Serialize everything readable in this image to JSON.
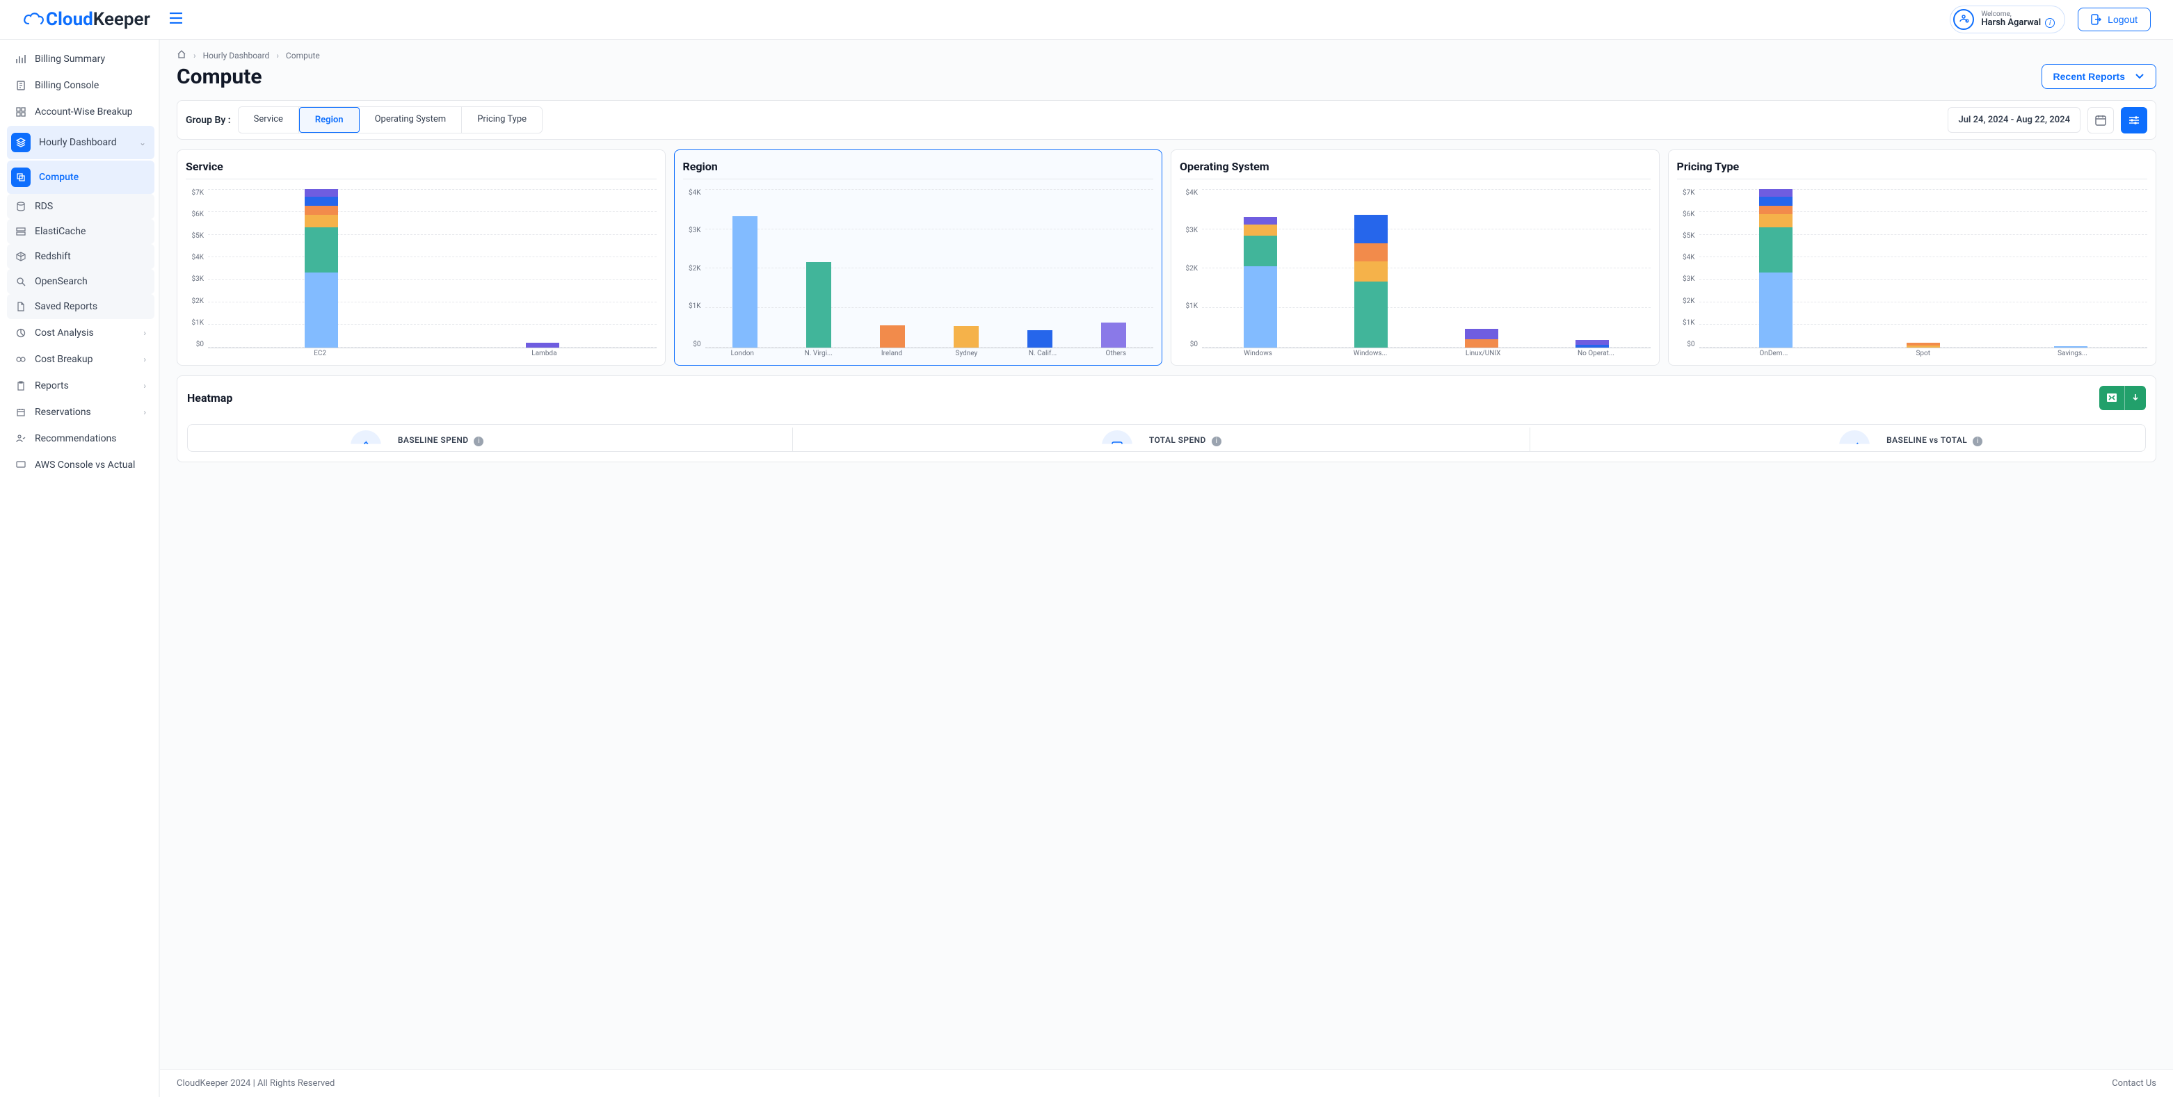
{
  "header": {
    "logo_part1": "Cloud",
    "logo_part2": "Keeper",
    "welcome_label": "Welcome,",
    "user_name": "Harsh Agarwal",
    "logout_label": "Logout"
  },
  "sidebar": {
    "items": {
      "billing_summary": "Billing Summary",
      "billing_console": "Billing Console",
      "account_wise": "Account-Wise Breakup",
      "hourly_dashboard": "Hourly Dashboard",
      "compute": "Compute",
      "rds": "RDS",
      "elasticache": "ElastiCache",
      "redshift": "Redshift",
      "opensearch": "OpenSearch",
      "saved_reports": "Saved Reports",
      "cost_analysis": "Cost Analysis",
      "cost_breakup": "Cost Breakup",
      "reports": "Reports",
      "reservations": "Reservations",
      "recommendations": "Recommendations",
      "aws_console_vs_actual": "AWS Console vs Actual"
    }
  },
  "breadcrumb": {
    "level1": "Hourly Dashboard",
    "level2": "Compute"
  },
  "page": {
    "title": "Compute",
    "recent_reports_label": "Recent Reports",
    "group_by_label": "Group By :",
    "group_by_options": {
      "service": "Service",
      "region": "Region",
      "os": "Operating System",
      "pricing": "Pricing Type"
    },
    "date_range": "Jul 24, 2024 - Aug 22, 2024"
  },
  "heatmap": {
    "title": "Heatmap",
    "baseline_spend_label": "BASELINE SPEND",
    "total_spend_label": "TOTAL SPEND",
    "baseline_vs_total_label": "BASELINE vs TOTAL"
  },
  "footer": {
    "copyright": "CloudKeeper 2024 | All Rights Reserved",
    "contact": "Contact Us"
  },
  "chart_data": [
    {
      "type": "bar",
      "title": "Service",
      "categories": [
        "EC2",
        "Lambda"
      ],
      "ylim": [
        0,
        7000
      ],
      "yticks": [
        "$7K",
        "$6K",
        "$5K",
        "$4K",
        "$3K",
        "$2K",
        "$1K",
        "$0"
      ],
      "series": [
        {
          "name": "sky",
          "color": "#82bbff",
          "values": [
            3000,
            0
          ]
        },
        {
          "name": "teal",
          "color": "#41b59a",
          "values": [
            1800,
            0
          ]
        },
        {
          "name": "amber",
          "color": "#f5b24a",
          "values": [
            500,
            0
          ]
        },
        {
          "name": "orange",
          "color": "#f28b4b",
          "values": [
            350,
            0
          ]
        },
        {
          "name": "blue",
          "color": "#2666eb",
          "values": [
            380,
            0
          ]
        },
        {
          "name": "violet",
          "color": "#6f5de0",
          "values": [
            300,
            180
          ]
        }
      ]
    },
    {
      "type": "bar",
      "title": "Region",
      "categories": [
        "London",
        "N. Virgi...",
        "Ireland",
        "Sydney",
        "N. Calif...",
        "Others"
      ],
      "ylim": [
        0,
        4000
      ],
      "yticks": [
        "$4K",
        "$3K",
        "$2K",
        "$1K",
        "$0"
      ],
      "series": [
        {
          "name": "value",
          "colors": [
            "#82bbff",
            "#41b59a",
            "#f28b4b",
            "#f5b24a",
            "#2666eb",
            "#8a79e8"
          ],
          "values": [
            3000,
            1950,
            510,
            490,
            400,
            570
          ]
        }
      ]
    },
    {
      "type": "bar",
      "title": "Operating System",
      "categories": [
        "Windows",
        "Windows...",
        "Linux/UNIX",
        "No Operat..."
      ],
      "ylim": [
        0,
        4000
      ],
      "yticks": [
        "$4K",
        "$3K",
        "$2K",
        "$1K",
        "$0"
      ],
      "series": [
        {
          "name": "sky",
          "color": "#82bbff",
          "values": [
            1850,
            0,
            0,
            0
          ]
        },
        {
          "name": "teal",
          "color": "#41b59a",
          "values": [
            700,
            1500,
            0,
            0
          ]
        },
        {
          "name": "amber",
          "color": "#f5b24a",
          "values": [
            250,
            460,
            0,
            0
          ]
        },
        {
          "name": "orange",
          "color": "#f28b4b",
          "values": [
            0,
            420,
            190,
            0
          ]
        },
        {
          "name": "blue",
          "color": "#2666eb",
          "values": [
            0,
            650,
            0,
            60
          ]
        },
        {
          "name": "violet",
          "color": "#6f5de0",
          "values": [
            180,
            0,
            230,
            120
          ]
        }
      ]
    },
    {
      "type": "bar",
      "title": "Pricing Type",
      "categories": [
        "OnDem...",
        "Spot",
        "Savings..."
      ],
      "ylim": [
        0,
        7000
      ],
      "yticks": [
        "$7K",
        "$6K",
        "$5K",
        "$4K",
        "$3K",
        "$2K",
        "$1K",
        "$0"
      ],
      "series": [
        {
          "name": "sky",
          "color": "#82bbff",
          "values": [
            3000,
            0,
            40
          ]
        },
        {
          "name": "teal",
          "color": "#41b59a",
          "values": [
            1800,
            0,
            0
          ]
        },
        {
          "name": "amber",
          "color": "#f5b24a",
          "values": [
            520,
            80,
            0
          ]
        },
        {
          "name": "orange",
          "color": "#f28b4b",
          "values": [
            350,
            110,
            0
          ]
        },
        {
          "name": "blue",
          "color": "#2666eb",
          "values": [
            360,
            0,
            0
          ]
        },
        {
          "name": "violet",
          "color": "#6f5de0",
          "values": [
            300,
            0,
            0
          ]
        }
      ]
    }
  ]
}
